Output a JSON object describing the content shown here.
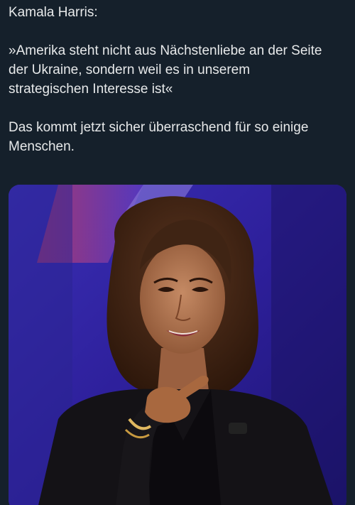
{
  "tweet": {
    "lines": [
      "Kamala Harris:",
      "»Amerika steht nicht aus Nächstenliebe an der Seite",
      "der Ukraine, sondern weil es in unserem",
      "strategischen Interesse ist«",
      "Das kommt jetzt sicher überraschend für so einige",
      "Menschen."
    ]
  },
  "media": {
    "type": "photo",
    "subject": "woman-pointing-photo"
  },
  "colors": {
    "background": "#15202b",
    "text": "#e7e9ea"
  }
}
